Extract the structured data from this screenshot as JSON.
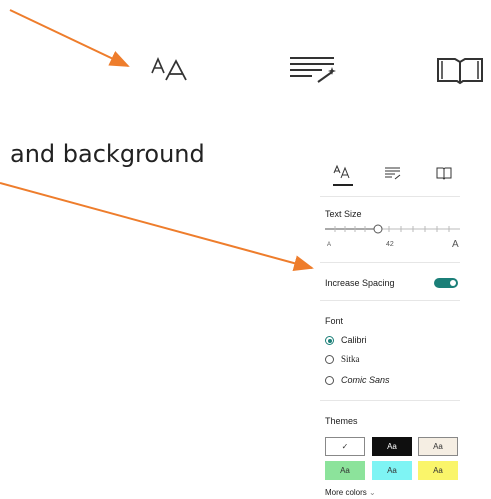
{
  "caption": {
    "text": "and background"
  },
  "panel": {
    "tabs": [
      {
        "name": "text-preferences",
        "icon": "text-size-icon"
      },
      {
        "name": "grammar-options",
        "icon": "grammar-icon"
      },
      {
        "name": "reading-preferences",
        "icon": "book-icon"
      }
    ],
    "text_size": {
      "label": "Text Size",
      "value": "42",
      "small_glyph": "A",
      "large_glyph": "A"
    },
    "spacing": {
      "label": "Increase Spacing",
      "enabled": true
    },
    "font": {
      "label": "Font",
      "options": [
        "Calibri",
        "Sitka",
        "Comic Sans"
      ],
      "selected": "Calibri"
    },
    "themes": {
      "label": "Themes",
      "swatches": [
        {
          "label": "✓",
          "bg": "#ffffff",
          "fg": "#333333"
        },
        {
          "label": "Aa",
          "bg": "#0f0f0f",
          "fg": "#ffffff"
        },
        {
          "label": "Aa",
          "bg": "#f5eee3",
          "fg": "#333333"
        },
        {
          "label": "Aa",
          "bg": "#8ce39b",
          "fg": "#333333"
        },
        {
          "label": "Aa",
          "bg": "#7ef4f4",
          "fg": "#333333"
        },
        {
          "label": "Aa",
          "bg": "#faf56a",
          "fg": "#333333"
        }
      ],
      "more": "More colors"
    }
  },
  "colors": {
    "arrow": "#ee7d2c",
    "accent": "#1b7f78"
  }
}
